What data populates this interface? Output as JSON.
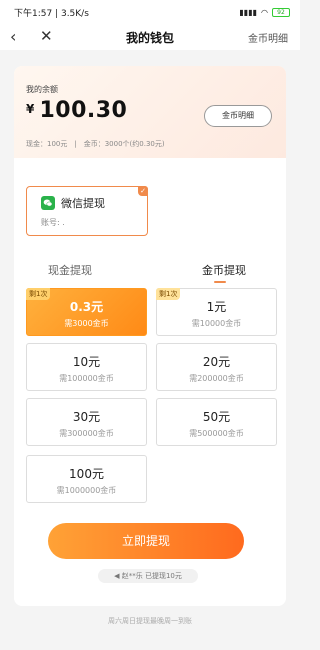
{
  "status": {
    "time_speed": "下午1:57 | 3.5K/s",
    "signal": "▮▮▮▮",
    "battery": "92"
  },
  "nav": {
    "title": "我的钱包",
    "right_link": "金币明细",
    "back_icon": "chevron-left-icon",
    "close_icon": "close-icon"
  },
  "balance": {
    "label": "我的余额",
    "symbol": "¥",
    "amount": "100.30",
    "coin_detail_button": "金币明细",
    "sub": "现金：100元　|　金币：3000个(约0.30元)"
  },
  "wechat": {
    "title": "微信提现",
    "account": "账号: ."
  },
  "tabs": {
    "cash": "现金提现",
    "coin": "金币提现"
  },
  "options": [
    {
      "amount": "0.3元",
      "need": "需3000金币",
      "badge": "剩1次",
      "selected": true
    },
    {
      "amount": "1元",
      "need": "需10000金币",
      "badge": "剩1次",
      "selected": false
    },
    {
      "amount": "10元",
      "need": "需100000金币",
      "badge": "",
      "selected": false
    },
    {
      "amount": "20元",
      "need": "需200000金币",
      "badge": "",
      "selected": false
    },
    {
      "amount": "30元",
      "need": "需300000金币",
      "badge": "",
      "selected": false
    },
    {
      "amount": "50元",
      "need": "需500000金币",
      "badge": "",
      "selected": false
    },
    {
      "amount": "100元",
      "need": "需1000000金币",
      "badge": "",
      "selected": false
    }
  ],
  "withdraw_button": "立即提现",
  "notice": "赵**乐 已提现10元",
  "footer": "周六周日提现最晚周一到账",
  "colors": {
    "accent": "#ff8a16",
    "wechat": "#2ab24a"
  }
}
